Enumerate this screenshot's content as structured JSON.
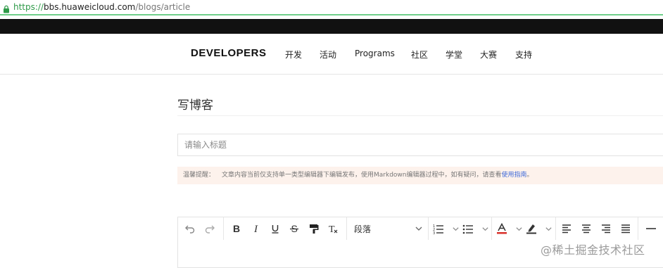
{
  "browser": {
    "url_scheme": "https://",
    "url_host": "bbs.huaweicloud.com",
    "url_path": "/blogs/article"
  },
  "nav": {
    "brand": "DEVELOPERS",
    "items": [
      "开发",
      "活动",
      "Programs",
      "社区",
      "学堂",
      "大赛",
      "支持"
    ]
  },
  "page": {
    "title": "写博客",
    "title_input_placeholder": "请输入标题",
    "notice_label": "温馨提醒：",
    "notice_text": "文章内容当前仅支持单一类型编辑器下编辑发布，使用Markdown编辑器过程中，如有疑问，请查看",
    "notice_link": "使用指南",
    "notice_end": "。"
  },
  "toolbar": {
    "paragraph_select": "段落"
  },
  "watermark": "@稀土掘金技术社区",
  "colors": {
    "url_scheme": "#2e9a48",
    "notice_bg": "#fdf2ec",
    "link": "#3f6ad8",
    "font_color_bar": "#d9312b"
  }
}
